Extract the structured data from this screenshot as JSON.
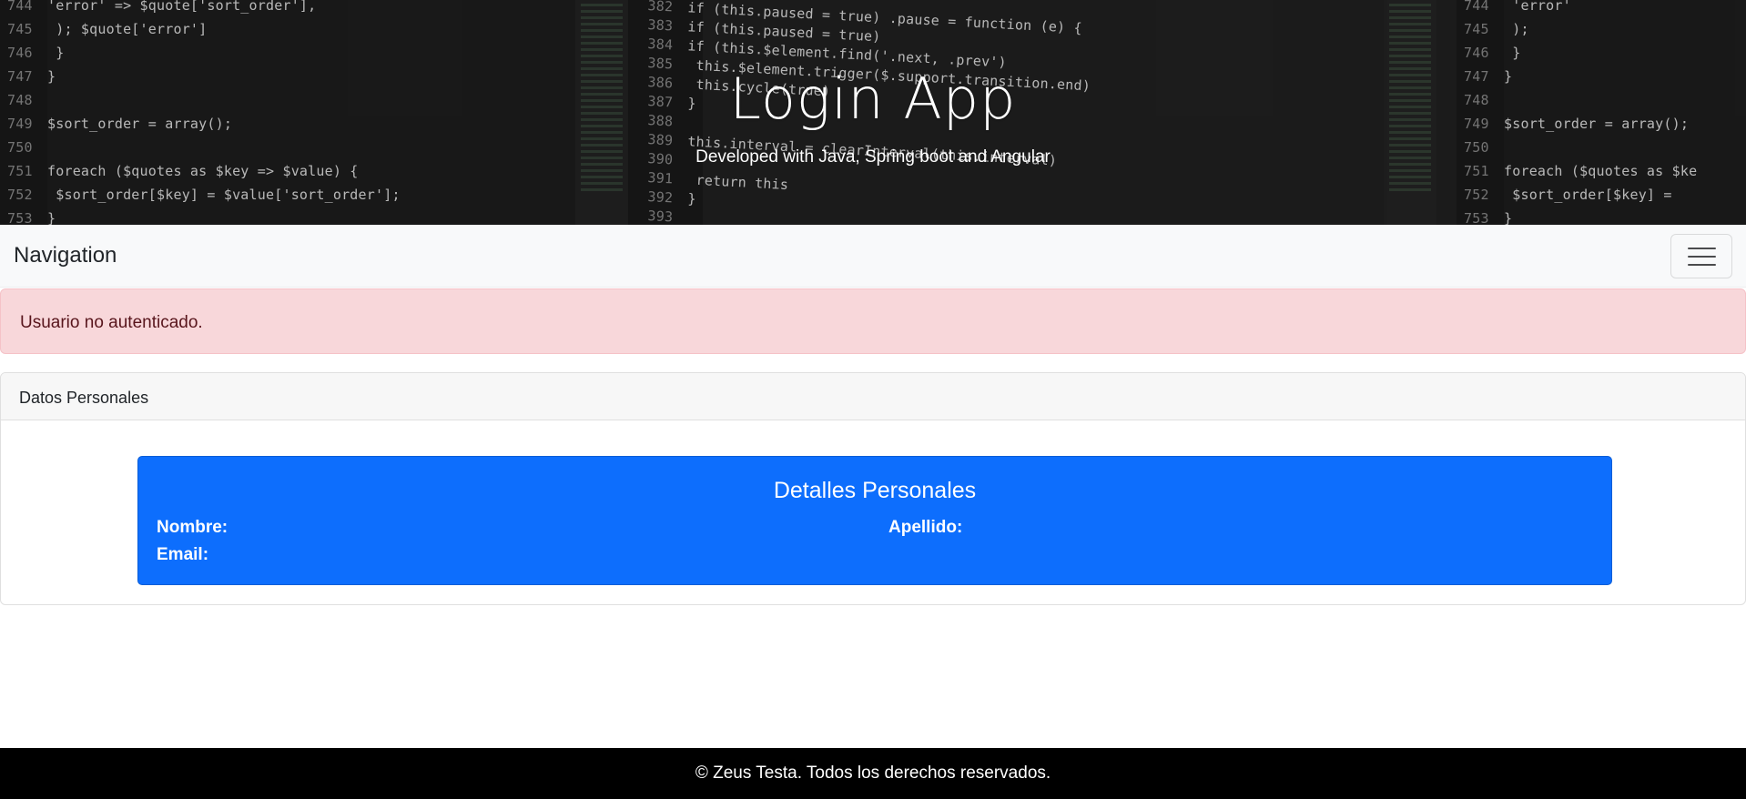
{
  "hero": {
    "title": "Login App",
    "subtitle": "Developed with Java, Spring boot and Angular"
  },
  "navbar": {
    "brand": "Navigation",
    "toggler_icon": "hamburger-menu-icon"
  },
  "alert": {
    "message": "Usuario no autenticado.",
    "color": "#f8d7da"
  },
  "card": {
    "header": "Datos Personales",
    "details": {
      "title": "Detalles Personales",
      "nombre_label": "Nombre:",
      "apellido_label": "Apellido:",
      "email_label": "Email:",
      "color": "#0d6efd"
    }
  },
  "footer": {
    "text": "© Zeus Testa. Todos los derechos reservados."
  },
  "background_code": {
    "left": [
      {
        "n": "744",
        "t": "'error' => $quote['sort_order'],"
      },
      {
        "n": "745",
        "t": "        );  $quote['error']"
      },
      {
        "n": "746",
        "t": "    }"
      },
      {
        "n": "747",
        "t": "}"
      },
      {
        "n": "748",
        "t": ""
      },
      {
        "n": "749",
        "t": "$sort_order = array();"
      },
      {
        "n": "750",
        "t": ""
      },
      {
        "n": "751",
        "t": "foreach ($quotes as $key => $value) {"
      },
      {
        "n": "752",
        "t": "    $sort_order[$key] = $value['sort_order'];"
      },
      {
        "n": "753",
        "t": "}"
      }
    ],
    "middle": [
      {
        "n": "382",
        "t": "if (this.paused = true)  .pause = function (e) {"
      },
      {
        "n": "383",
        "t": "if (this.paused = true)"
      },
      {
        "n": "384",
        "t": "if (this.$element.find('.next, .prev')"
      },
      {
        "n": "385",
        "t": "  this.$element.trigger($.support.transition.end)"
      },
      {
        "n": "386",
        "t": "  this.cycle(true)"
      },
      {
        "n": "387",
        "t": "}"
      },
      {
        "n": "388",
        "t": ""
      },
      {
        "n": "389",
        "t": "this.interval = clearInterval(this.interval)"
      },
      {
        "n": "390",
        "t": ""
      },
      {
        "n": "391",
        "t": "  return this"
      },
      {
        "n": "392",
        "t": "}"
      },
      {
        "n": "393",
        "t": ""
      }
    ],
    "right": [
      {
        "n": "744",
        "t": "        'error'"
      },
      {
        "n": "745",
        "t": "        );"
      },
      {
        "n": "746",
        "t": "    }"
      },
      {
        "n": "747",
        "t": "}"
      },
      {
        "n": "748",
        "t": ""
      },
      {
        "n": "749",
        "t": "$sort_order = array();"
      },
      {
        "n": "750",
        "t": ""
      },
      {
        "n": "751",
        "t": "foreach ($quotes as $ke"
      },
      {
        "n": "752",
        "t": "    $sort_order[$key] ="
      },
      {
        "n": "753",
        "t": "}"
      }
    ]
  }
}
